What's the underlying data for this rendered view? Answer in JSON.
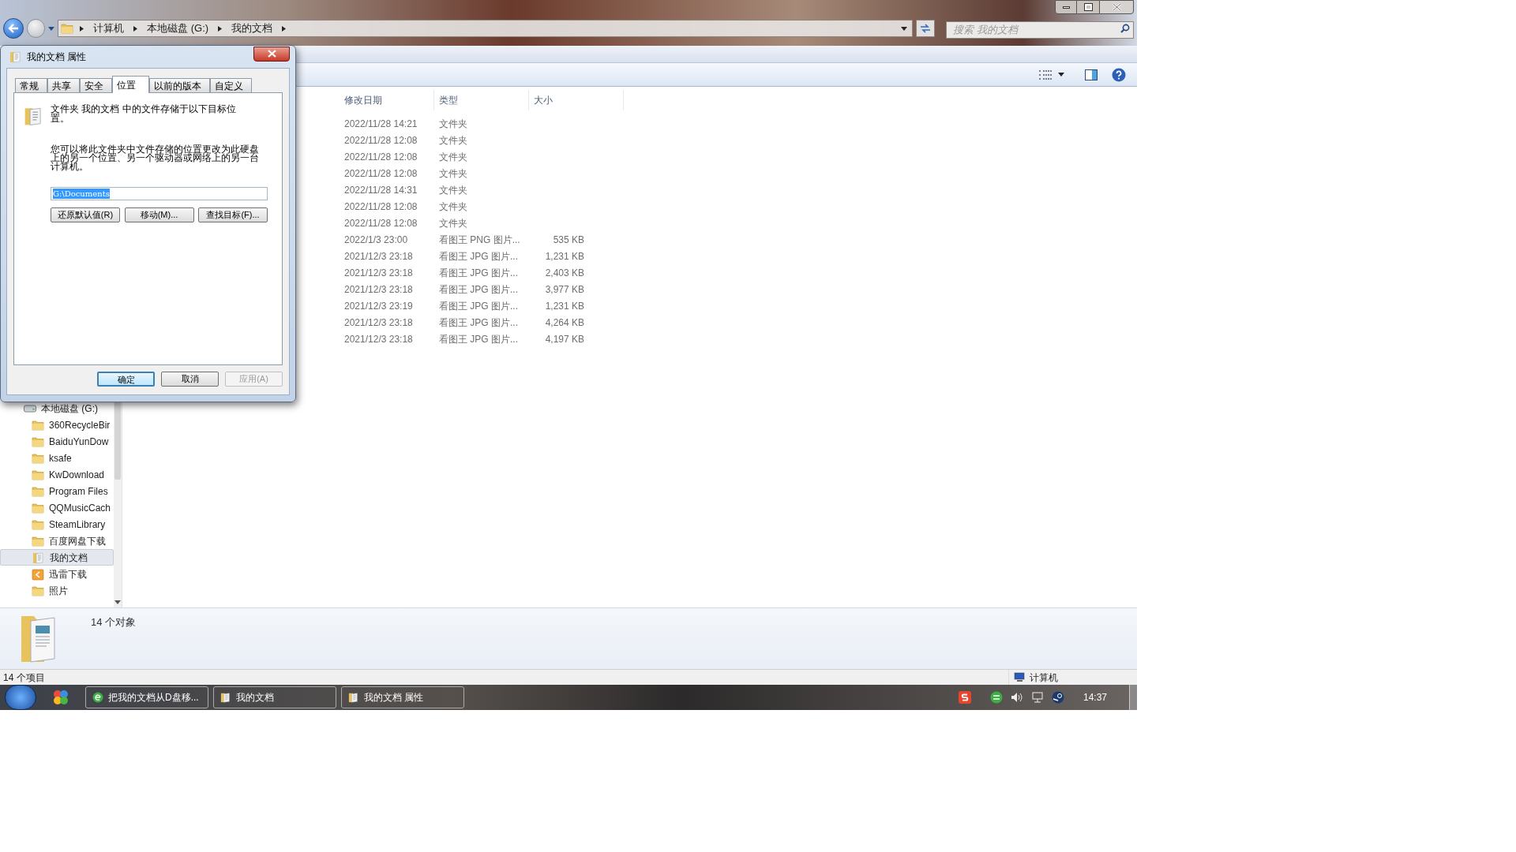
{
  "explorer": {
    "address": {
      "crumbs": [
        "计算机",
        "本地磁盘 (G:)",
        "我的文档"
      ]
    },
    "search": {
      "placeholder": "搜索 我的文档"
    },
    "columns": [
      "修改日期",
      "类型",
      "大小"
    ],
    "rows": [
      {
        "date": "2022/11/28 14:21",
        "type": "文件夹",
        "size": ""
      },
      {
        "date": "2022/11/28 12:08",
        "type": "文件夹",
        "size": ""
      },
      {
        "date": "2022/11/28 12:08",
        "type": "文件夹",
        "size": ""
      },
      {
        "date": "2022/11/28 12:08",
        "type": "文件夹",
        "size": ""
      },
      {
        "date": "2022/11/28 14:31",
        "type": "文件夹",
        "size": ""
      },
      {
        "date": "2022/11/28 12:08",
        "type": "文件夹",
        "size": ""
      },
      {
        "date": "2022/11/28 12:08",
        "type": "文件夹",
        "size": ""
      },
      {
        "date": "2022/1/3 23:00",
        "type": "看图王 PNG 图片...",
        "size": "535 KB"
      },
      {
        "date": "2021/12/3 23:18",
        "type": "看图王 JPG 图片...",
        "size": "1,231 KB"
      },
      {
        "date": "2021/12/3 23:18",
        "type": "看图王 JPG 图片...",
        "size": "2,403 KB"
      },
      {
        "date": "2021/12/3 23:18",
        "type": "看图王 JPG 图片...",
        "size": "3,977 KB"
      },
      {
        "date": "2021/12/3 23:19",
        "type": "看图王 JPG 图片...",
        "size": "1,231 KB"
      },
      {
        "date": "2021/12/3 23:18",
        "type": "看图王 JPG 图片...",
        "size": "4,264 KB"
      },
      {
        "date": "2021/12/3 23:18",
        "type": "看图王 JPG 图片...",
        "size": "4,197 KB"
      }
    ],
    "nav": [
      {
        "label": "本地磁盘 (G:)",
        "kind": "drive",
        "selected": false
      },
      {
        "label": "360RecycleBir",
        "kind": "folder",
        "selected": false
      },
      {
        "label": "BaiduYunDow",
        "kind": "folder",
        "selected": false
      },
      {
        "label": "ksafe",
        "kind": "folder",
        "selected": false
      },
      {
        "label": "KwDownload",
        "kind": "folder",
        "selected": false
      },
      {
        "label": "Program Files",
        "kind": "folder",
        "selected": false
      },
      {
        "label": "QQMusicCach",
        "kind": "folder",
        "selected": false
      },
      {
        "label": "SteamLibrary",
        "kind": "folder",
        "selected": false
      },
      {
        "label": "百度网盘下载",
        "kind": "folder",
        "selected": false
      },
      {
        "label": "我的文档",
        "kind": "documents",
        "selected": true
      },
      {
        "label": "迅雷下载",
        "kind": "download",
        "selected": false
      },
      {
        "label": "照片",
        "kind": "folder",
        "selected": false
      }
    ],
    "details": {
      "count": "14 个对象"
    },
    "status_bar": {
      "items": "14 个项目",
      "location": "计算机"
    }
  },
  "dialog": {
    "title": "我的文档 属性",
    "tabs": [
      {
        "label": "常规",
        "selected": false
      },
      {
        "label": "共享",
        "selected": false
      },
      {
        "label": "安全",
        "selected": false
      },
      {
        "label": "位置",
        "selected": true
      },
      {
        "label": "以前的版本",
        "selected": false
      },
      {
        "label": "自定义",
        "selected": false
      }
    ],
    "intro": "文件夹 我的文档 中的文件存储于以下目标位置。",
    "explanation": "您可以将此文件夹中文件存储的位置更改为此硬盘上的另一个位置、另一个驱动器或网络上的另一台计算机。",
    "location": {
      "value": "G:\\Documents",
      "highlighted": true
    },
    "actions": [
      "还原默认值(R)",
      "移动(M)...",
      "查找目标(F)..."
    ],
    "buttons": [
      {
        "label": "确定",
        "default": true,
        "disabled": false
      },
      {
        "label": "取消",
        "default": false,
        "disabled": false
      },
      {
        "label": "应用(A)",
        "default": false,
        "disabled": true
      }
    ]
  },
  "taskbar": {
    "tasks": [
      {
        "label": "把我的文档从D盘移...",
        "kind": "browser"
      },
      {
        "label": "我的文档",
        "kind": "folder"
      },
      {
        "label": "我的文档 属性",
        "kind": "folder"
      }
    ],
    "clock": "14:37"
  }
}
